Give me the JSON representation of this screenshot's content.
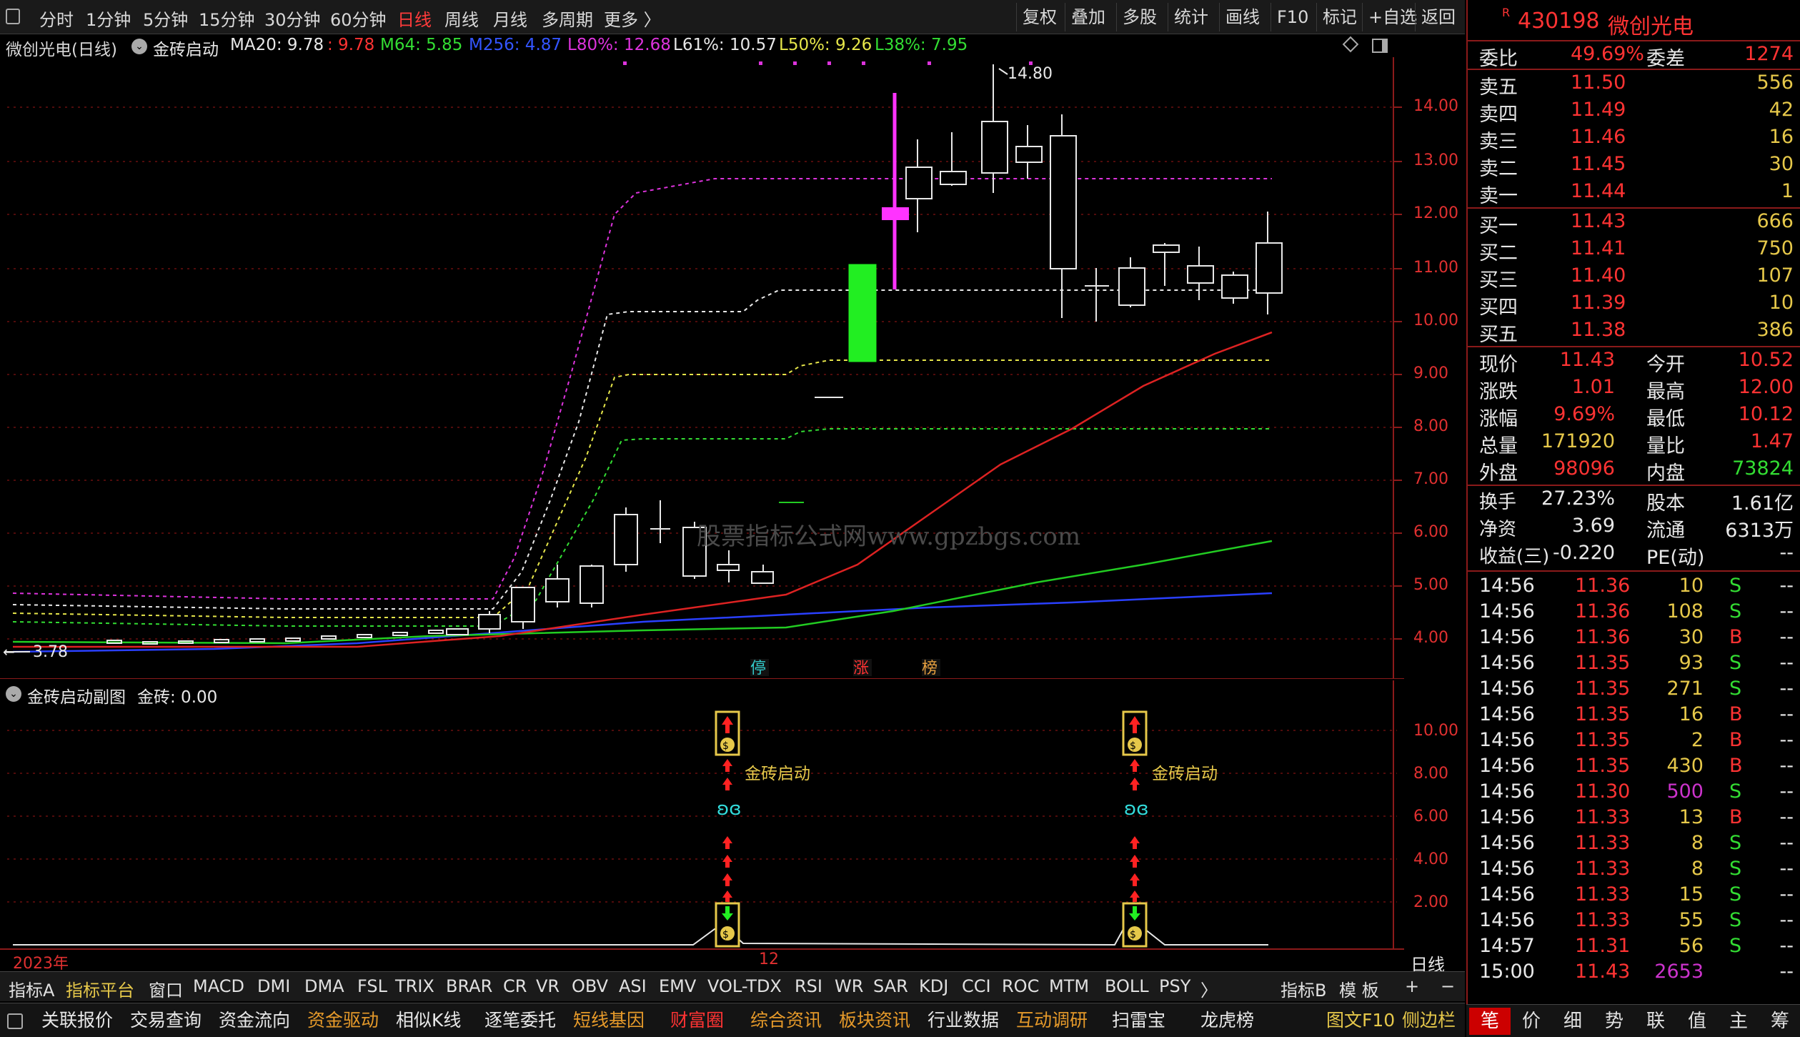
{
  "toolbar": {
    "periods": [
      "分时",
      "1分钟",
      "5分钟",
      "15分钟",
      "30分钟",
      "60分钟",
      "日线",
      "周线",
      "月线",
      "多周期",
      "更多 〉"
    ],
    "active_period": "日线",
    "tools": [
      "复权",
      "叠加",
      "多股",
      "统计",
      "画线",
      "F10",
      "标记",
      "+自选",
      "返回"
    ]
  },
  "main_chart": {
    "stock_label": "微创光电(日线)",
    "indicator_name": "金砖启动",
    "ma20": "MA20: 9.78",
    "ma20_tail": ": 9.78",
    "m64": "M64: 5.85",
    "m256": "M256: 4.87",
    "l80": "L80%: 12.68",
    "l61": "L61%: 10.57",
    "l50": "L50%: 9.26",
    "l38": "L38%: 7.95",
    "high_label": "14.80",
    "low_label": "3.78",
    "y_ticks": [
      "14.00",
      "13.00",
      "12.00",
      "11.00",
      "10.00",
      "9.00",
      "8.00",
      "7.00",
      "6.00",
      "5.00",
      "4.00"
    ],
    "watermark": "股票指标公式网www.gpzbgs.com",
    "markers": [
      "停",
      "涨",
      "榜"
    ]
  },
  "sub_chart": {
    "title": "金砖启动副图",
    "value": "金砖: 0.00",
    "signal_label": "金砖启动",
    "y_ticks": [
      "10.00",
      "8.00",
      "6.00",
      "4.00",
      "2.00"
    ]
  },
  "timeline": {
    "year": "2023年",
    "month": "12",
    "period_label": "日线"
  },
  "indicators": [
    "指标A",
    "指标平台",
    "窗口",
    "MACD",
    "DMI",
    "DMA",
    "FSL",
    "TRIX",
    "BRAR",
    "CR",
    "VR",
    "OBV",
    "ASI",
    "EMV",
    "VOL-TDX",
    "RSI",
    "WR",
    "SAR",
    "KDJ",
    "CCI",
    "ROC",
    "MTM",
    "BOLL",
    "PSY",
    "〉"
  ],
  "indicator_right": [
    "指标B",
    "模 板",
    "+",
    "−"
  ],
  "functions": [
    "关联报价",
    "交易查询",
    "资金流向",
    "资金驱动",
    "相似K线",
    "逐笔委托",
    "短线基因",
    "财富圈",
    "综合资讯",
    "板块资讯",
    "行业数据",
    "互动调研",
    "扫雷宝",
    "龙虎榜",
    "图文F10",
    "侧边栏"
  ],
  "quote": {
    "code": "430198",
    "name": "微创光电",
    "webi_label": "委比",
    "webi": "49.69%",
    "weicha_label": "委差",
    "weicha": "1274",
    "asks": [
      {
        "label": "卖五",
        "price": "11.50",
        "vol": "556"
      },
      {
        "label": "卖四",
        "price": "11.49",
        "vol": "42"
      },
      {
        "label": "卖三",
        "price": "11.46",
        "vol": "16"
      },
      {
        "label": "卖二",
        "price": "11.45",
        "vol": "30"
      },
      {
        "label": "卖一",
        "price": "11.44",
        "vol": "1"
      }
    ],
    "bids": [
      {
        "label": "买一",
        "price": "11.43",
        "vol": "666"
      },
      {
        "label": "买二",
        "price": "11.41",
        "vol": "750"
      },
      {
        "label": "买三",
        "price": "11.40",
        "vol": "107"
      },
      {
        "label": "买四",
        "price": "11.39",
        "vol": "10"
      },
      {
        "label": "买五",
        "price": "11.38",
        "vol": "386"
      }
    ],
    "stats": [
      {
        "l1": "现价",
        "v1": "11.43",
        "l2": "今开",
        "v2": "10.52"
      },
      {
        "l1": "涨跌",
        "v1": "1.01",
        "l2": "最高",
        "v2": "12.00"
      },
      {
        "l1": "涨幅",
        "v1": "9.69%",
        "l2": "最低",
        "v2": "10.12"
      },
      {
        "l1": "总量",
        "v1": "171920",
        "l2": "量比",
        "v2": "1.47"
      },
      {
        "l1": "外盘",
        "v1": "98096",
        "l2": "内盘",
        "v2": "73824"
      }
    ],
    "stats2": [
      {
        "l1": "换手",
        "v1": "27.23%",
        "l2": "股本",
        "v2": "1.61亿"
      },
      {
        "l1": "净资",
        "v1": "3.69",
        "l2": "流通",
        "v2": "6313万"
      },
      {
        "l1": "收益(三)",
        "v1": "-0.220",
        "l2": "PE(动)",
        "v2": "--"
      }
    ],
    "ticks": [
      {
        "t": "14:56",
        "p": "11.36",
        "v": "10",
        "s": "S"
      },
      {
        "t": "14:56",
        "p": "11.36",
        "v": "108",
        "s": "S"
      },
      {
        "t": "14:56",
        "p": "11.36",
        "v": "30",
        "s": "B"
      },
      {
        "t": "14:56",
        "p": "11.35",
        "v": "93",
        "s": "S"
      },
      {
        "t": "14:56",
        "p": "11.35",
        "v": "271",
        "s": "S"
      },
      {
        "t": "14:56",
        "p": "11.35",
        "v": "16",
        "s": "B"
      },
      {
        "t": "14:56",
        "p": "11.35",
        "v": "2",
        "s": "B"
      },
      {
        "t": "14:56",
        "p": "11.35",
        "v": "430",
        "s": "B"
      },
      {
        "t": "14:56",
        "p": "11.30",
        "v": "500",
        "s": "S"
      },
      {
        "t": "14:56",
        "p": "11.33",
        "v": "13",
        "s": "B"
      },
      {
        "t": "14:56",
        "p": "11.33",
        "v": "8",
        "s": "S"
      },
      {
        "t": "14:56",
        "p": "11.33",
        "v": "8",
        "s": "S"
      },
      {
        "t": "14:56",
        "p": "11.33",
        "v": "15",
        "s": "S"
      },
      {
        "t": "14:56",
        "p": "11.33",
        "v": "55",
        "s": "S"
      },
      {
        "t": "14:57",
        "p": "11.31",
        "v": "56",
        "s": "S"
      },
      {
        "t": "15:00",
        "p": "11.43",
        "v": "2653",
        "s": ""
      }
    ],
    "tick_dash": "--",
    "tabs": [
      "笔",
      "价",
      "细",
      "势",
      "联",
      "值",
      "主",
      "筹"
    ],
    "colors": {
      "up": "#ff3333",
      "down": "#33dd33",
      "neutral": "#e8e8e8",
      "label": "#e8e8e8",
      "yellow": "#e6c84a",
      "purple": "#cc33cc"
    }
  }
}
